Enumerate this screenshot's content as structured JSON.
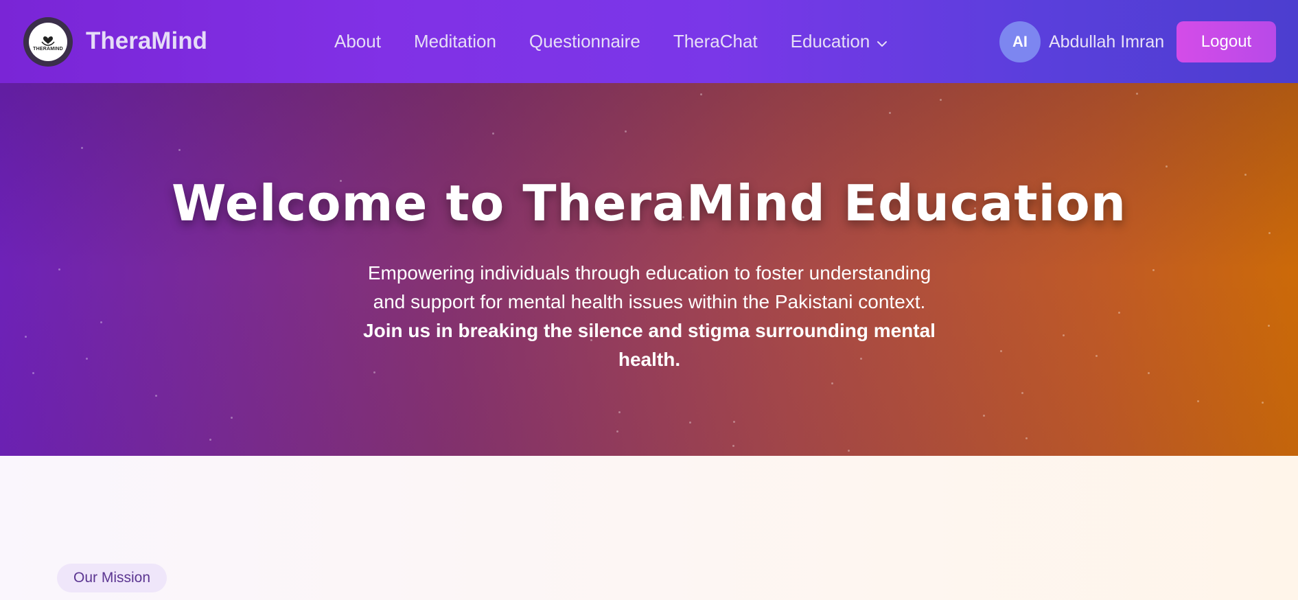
{
  "navbar": {
    "brand": "TheraMind",
    "logo_text": "THERAMIND",
    "links": [
      {
        "label": "About"
      },
      {
        "label": "Meditation"
      },
      {
        "label": "Questionnaire"
      },
      {
        "label": "TheraChat"
      },
      {
        "label": "Education"
      }
    ],
    "user": {
      "initials": "AI",
      "name": "Abdullah Imran"
    },
    "logout_label": "Logout"
  },
  "hero": {
    "title": "Welcome to TheraMind Education",
    "subtitle_plain": "Empowering individuals through education to foster understanding and support for mental health issues within the Pakistani context.",
    "subtitle_bold": "Join us in breaking the silence and stigma surrounding mental health."
  },
  "section": {
    "badge": "Our Mission"
  },
  "colors": {
    "nav_start": "#7a25d6",
    "nav_end": "#4c3ecf",
    "hero_start": "#6e22b8",
    "hero_end": "#cc6a08",
    "logout": "#d44ce8",
    "avatar": "#7d86f0"
  },
  "icons": {
    "dropdown": "chevron-down-icon",
    "logo": "heart-hands-logo-icon"
  }
}
